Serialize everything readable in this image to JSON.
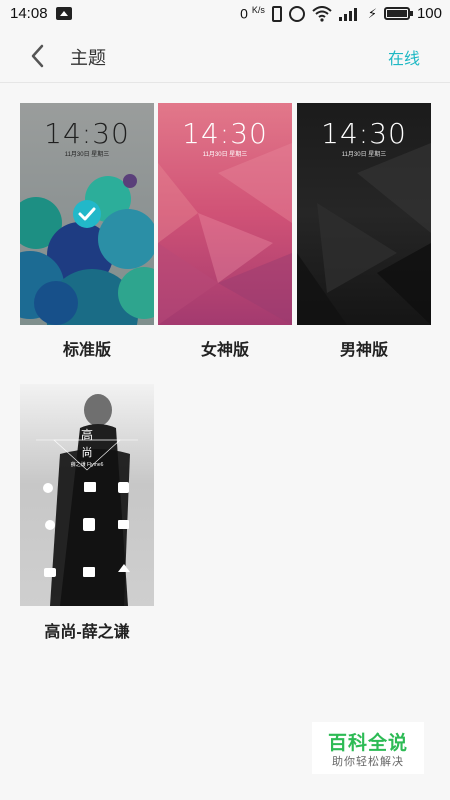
{
  "status_bar": {
    "time": "14:08",
    "net_speed_value": "0",
    "net_speed_unit": "K/s",
    "battery": "100"
  },
  "header": {
    "title": "主题",
    "online_label": "在线"
  },
  "themes": [
    {
      "name": "标准版",
      "lock_time": "14:30",
      "lock_date": "11月30日 星期三",
      "selected": true
    },
    {
      "name": "女神版",
      "lock_time": "14:30",
      "lock_date": "11月30日 星期三",
      "selected": false
    },
    {
      "name": "男神版",
      "lock_time": "14:30",
      "lock_date": "11月30日 星期三",
      "selected": false
    },
    {
      "name": "高尚-薛之谦",
      "cover_title_1": "高",
      "cover_title_2": "尚",
      "cover_caption": "薛之谦 Flyme6",
      "selected": false
    }
  ],
  "watermark": {
    "title": "百科全说",
    "subtitle": "助你轻松解决"
  },
  "colors": {
    "accent": "#1fb8c4",
    "watermark_green": "#2dbb55"
  }
}
